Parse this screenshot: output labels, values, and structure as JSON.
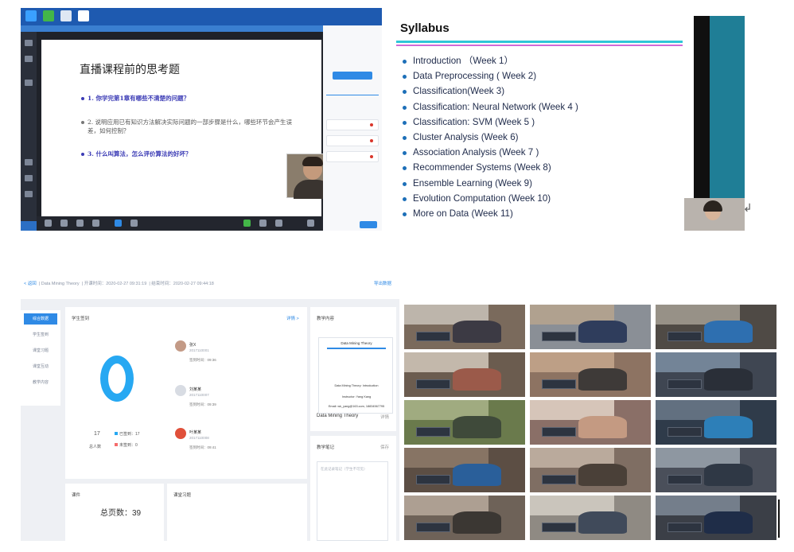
{
  "panel1": {
    "slide_title": "直播课程前的思考题",
    "questions": [
      "1. 你学完第1章有哪些不清楚的问题？",
      "2. 说明应用已有知识方法解决实际问题的一部步骤是什么，哪些环节会产生误差，如何控制？",
      "3. 什么叫算法，怎么评价算法的好坏？"
    ],
    "accent_color": "#2b6fc4"
  },
  "panel2": {
    "title": "Syllabus",
    "items": [
      "Introduction （Week 1）",
      "Data Preprocessing ( Week 2)",
      "Classification(Week 3)",
      "Classification: Neural Network (Week 4 )",
      "Classification: SVM (Week 5 )",
      "Cluster Analysis (Week  6)",
      "Association Analysis (Week 7 )",
      "Recommender Systems (Week 8)",
      "Ensemble Learning (Week 9)",
      "Evolution Computation (Week 10)",
      "More on Data  (Week 11)"
    ],
    "return_mark": "↲"
  },
  "panel3": {
    "back": "< 返回",
    "course": "Data Mining Theory",
    "start_time": "开课时间：2020-02-27 09:31:19",
    "end_time": "结束时间：2020-02-27 09:44:18",
    "export": "导出数据",
    "side_items": [
      "综合数据",
      "学生签到",
      "课堂习题",
      "课堂互动",
      "教学内容"
    ],
    "attendance": {
      "title": "学生签到",
      "detail_link": "详情 >",
      "total_value": "17",
      "total_label": "总人数",
      "signed": "已签到：17",
      "unsigned": "未签到：0"
    },
    "students": [
      {
        "name": "张X",
        "id": "2017110001",
        "time": "签到时间：09:36"
      },
      {
        "name": "刘某某",
        "id": "2017110007",
        "time": "签到时间：09:39"
      },
      {
        "name": "叶某某",
        "id": "2017110008",
        "time": "签到时间：09:41"
      }
    ],
    "content": {
      "title": "教学内容",
      "slide_title": "Data Mining Theory",
      "slide_lines": [
        "Data Mining Theory: Introduction",
        "Instructor: Yang Kang",
        "Email: wk_yang@163.com, 18834567795"
      ],
      "file_name": "Data Mining Theory",
      "file_link": "详情"
    },
    "notes": {
      "title": "教学笔记",
      "action": "保存",
      "placeholder": "在此记录笔记（学生不可见）"
    },
    "exercise": {
      "title": "课件",
      "total": "总页数：39"
    },
    "interaction": {
      "title": "课堂习题"
    }
  }
}
